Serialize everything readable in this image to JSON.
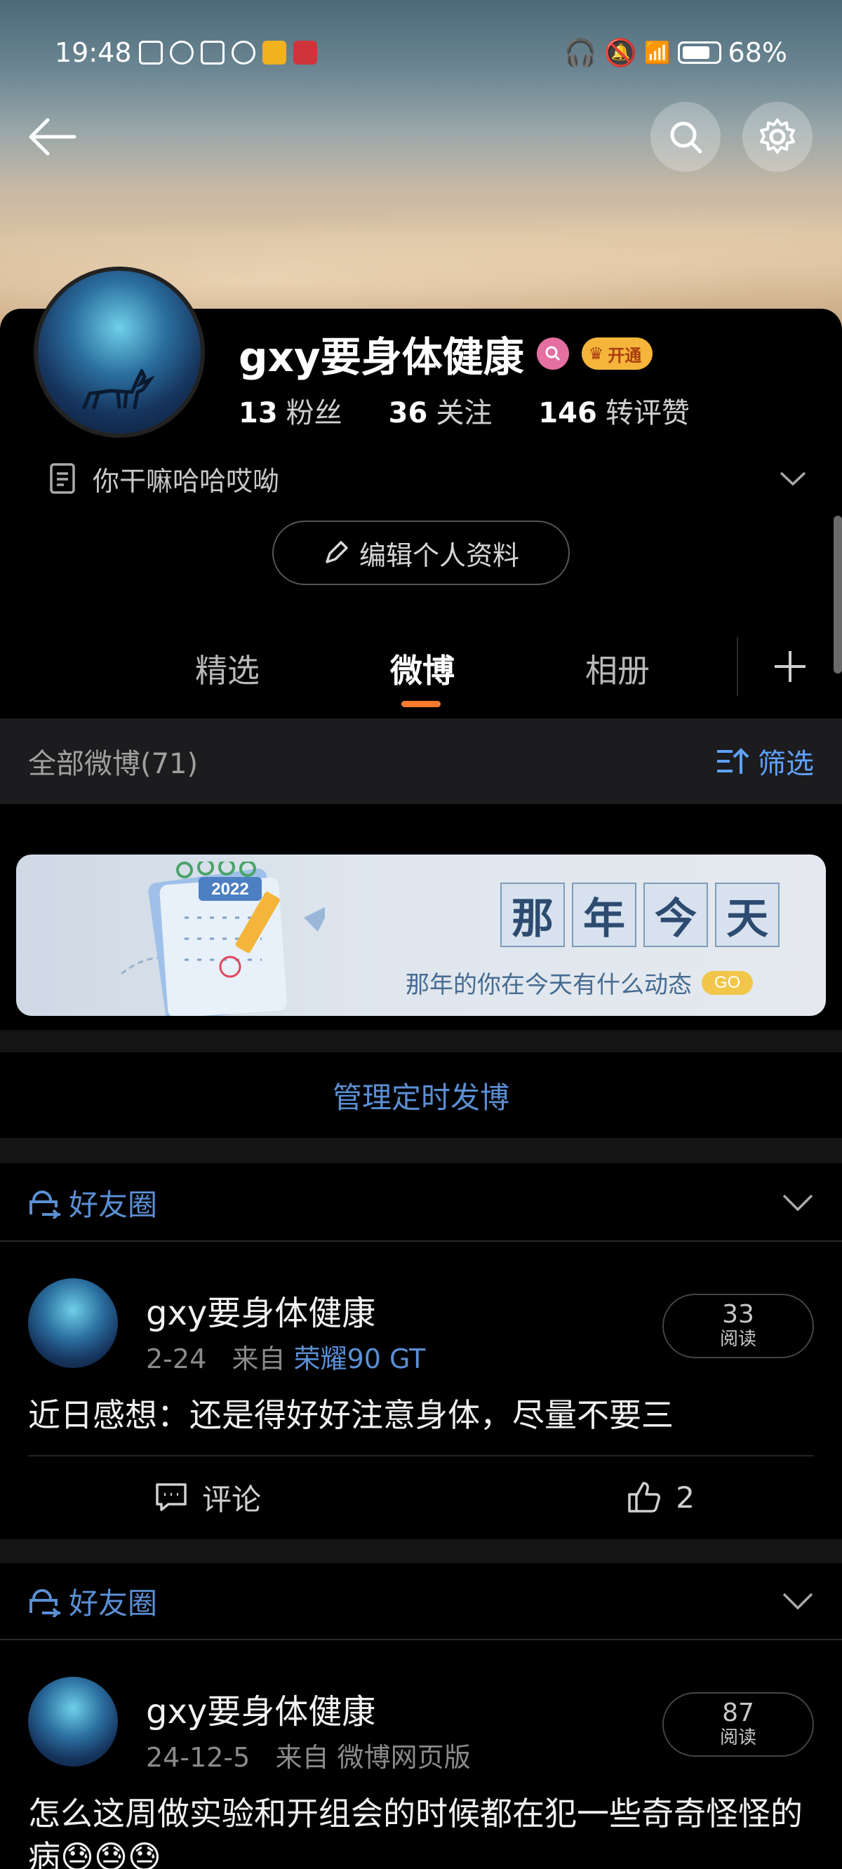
{
  "status_bar": {
    "time": "19:48",
    "battery": "68%"
  },
  "profile": {
    "username": "gxy要身体健康",
    "vip_label": "开通",
    "stats": [
      {
        "num": "13",
        "label": "粉丝"
      },
      {
        "num": "36",
        "label": "关注"
      },
      {
        "num": "146",
        "label": "转评赞"
      }
    ],
    "bio": "你干嘛哈哈哎呦",
    "edit_label": "编辑个人资料"
  },
  "tabs": [
    "精选",
    "微博",
    "相册"
  ],
  "active_tab": "微博",
  "filter_bar": {
    "all_label": "全部微博(71)",
    "filter_label": "筛选"
  },
  "banner": {
    "chars": [
      "那",
      "年",
      "今",
      "天"
    ],
    "subtitle": "那年的你在今天有什么动态",
    "go": "GO",
    "calendar_year": "2022"
  },
  "manage_label": "管理定时发博",
  "posts": [
    {
      "circle_label": "好友圈",
      "name": "gxy要身体健康",
      "date": "2-24",
      "from_label": "来自",
      "source": "荣耀90 GT",
      "reads": "33",
      "reads_label": "阅读",
      "text": "近日感想：还是得好好注意身体，尽量不要三",
      "comment_label": "评论",
      "likes": "2"
    },
    {
      "circle_label": "好友圈",
      "name": "gxy要身体健康",
      "date": "24-12-5",
      "from_label": "来自",
      "source": "微博网页版",
      "reads": "87",
      "reads_label": "阅读",
      "text": "怎么这周做实验和开组会的时候都在犯一些奇奇怪怪的病"
    }
  ],
  "colors": {
    "accent_orange": "#ff7a2e",
    "link_blue": "#5b8fd4",
    "filter_blue": "#5ea1ff"
  }
}
